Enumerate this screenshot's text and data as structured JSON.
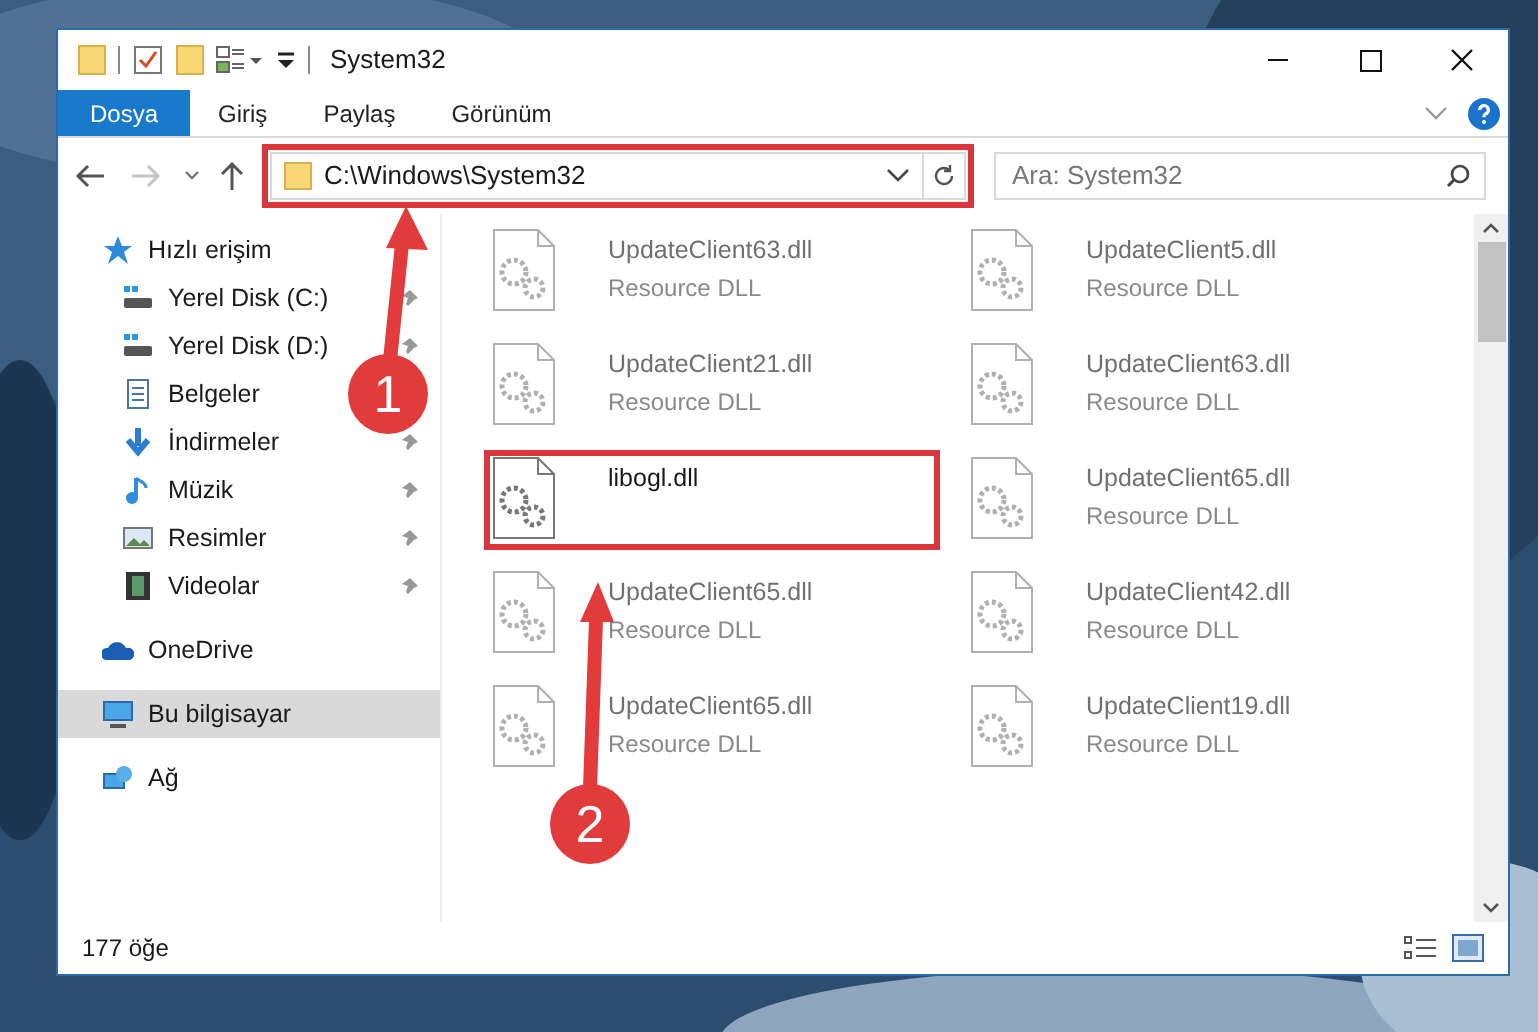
{
  "window": {
    "title": "System32"
  },
  "ribbon": {
    "tabs": [
      {
        "label": "Dosya",
        "selected": true
      },
      {
        "label": "Giriş",
        "selected": false
      },
      {
        "label": "Paylaş",
        "selected": false
      },
      {
        "label": "Görünüm",
        "selected": false
      }
    ]
  },
  "address_bar": {
    "path": "C:\\Windows\\System32"
  },
  "search": {
    "placeholder": "Ara: System32"
  },
  "sidebar": {
    "items": [
      {
        "label": "Hızlı erişim",
        "kind": "star",
        "selected": false
      },
      {
        "label": "Yerel Disk (C:)",
        "kind": "drive",
        "pinned": true,
        "selected": false
      },
      {
        "label": "Yerel Disk (D:)",
        "kind": "drive",
        "pinned": true,
        "selected": false
      },
      {
        "label": "Belgeler",
        "kind": "document",
        "selected": false
      },
      {
        "label": "İndirmeler",
        "kind": "download",
        "pinned": true,
        "selected": false
      },
      {
        "label": "Müzik",
        "kind": "music",
        "pinned": true,
        "selected": false
      },
      {
        "label": "Resimler",
        "pinned": true,
        "selected": false
      },
      {
        "label": "Videolar",
        "kind": "video",
        "pinned": true,
        "selected": false
      },
      {
        "label": "OneDrive",
        "kind": "cloud",
        "selected": false
      },
      {
        "label": "Bu bilgisayar",
        "kind": "computer",
        "selected": true
      },
      {
        "label": "Ağ",
        "kind": "network",
        "selected": false
      }
    ]
  },
  "files": [
    {
      "name": "UpdateClient63.dll",
      "type": "Resource DLL",
      "highlighted": false
    },
    {
      "name": "UpdateClient5.dll",
      "type": "Resource DLL",
      "highlighted": false
    },
    {
      "name": "UpdateClient21.dll",
      "type": "Resource DLL",
      "highlighted": false
    },
    {
      "name": "UpdateClient63.dll",
      "type": "Resource DLL",
      "highlighted": false
    },
    {
      "name": "libogl.dll",
      "highlighted": true
    },
    {
      "name": "UpdateClient65.dll",
      "type": "Resource DLL",
      "highlighted": false
    },
    {
      "name": "UpdateClient65.dll",
      "type": "Resource DLL",
      "highlighted": false
    },
    {
      "name": "UpdateClient42.dll",
      "type": "Resource DLL",
      "highlighted": false
    },
    {
      "name": "UpdateClient65.dll",
      "type": "Resource DLL",
      "highlighted": false
    },
    {
      "name": "UpdateClient19.dll",
      "type": "Resource DLL",
      "highlighted": false
    }
  ],
  "status_bar": {
    "item_count": "177 öğe"
  },
  "annotations": [
    {
      "number": "1"
    },
    {
      "number": "2"
    }
  ]
}
